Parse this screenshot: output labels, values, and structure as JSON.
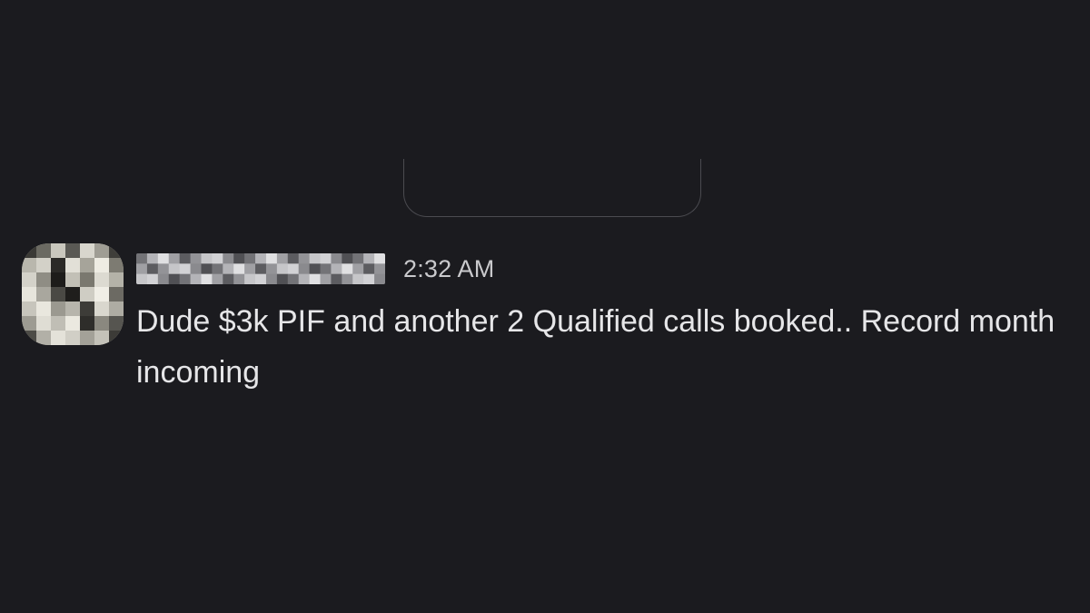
{
  "message": {
    "sender_name": "",
    "timestamp": "2:32 AM",
    "text": "Dude $3k PIF and another 2 Qualified calls booked.. Record month incoming"
  },
  "colors": {
    "background": "#1b1b1f",
    "text": "#e6e6e8",
    "timestamp": "#c9c9cc",
    "divider": "#4b4b50"
  }
}
